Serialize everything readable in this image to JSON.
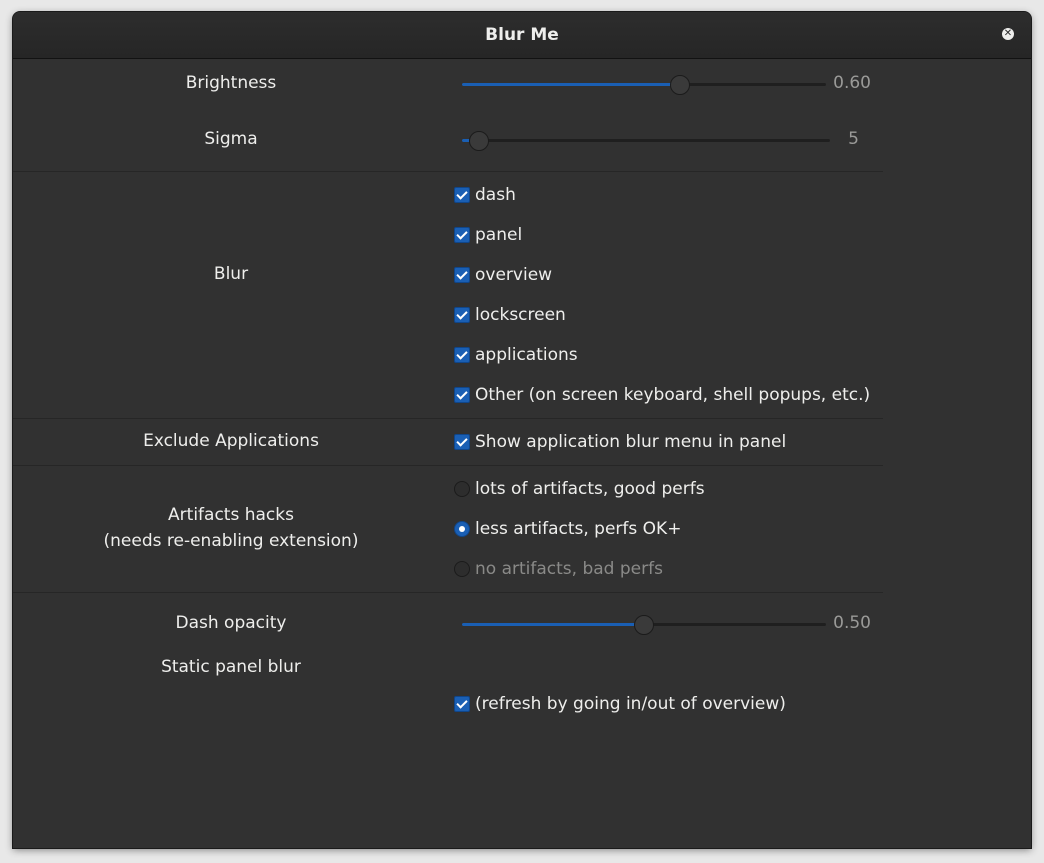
{
  "window": {
    "title": "Blur Me",
    "close_symbol": "✕"
  },
  "brightness": {
    "label": "Brightness",
    "value": 0.6,
    "value_text": "0.60"
  },
  "sigma": {
    "label": "Sigma",
    "value": 5,
    "max": 111,
    "value_text": "5"
  },
  "blur": {
    "label": "Blur",
    "options": [
      {
        "label": "dash",
        "checked": true
      },
      {
        "label": "panel",
        "checked": true
      },
      {
        "label": "overview",
        "checked": true
      },
      {
        "label": "lockscreen",
        "checked": true
      },
      {
        "label": "applications",
        "checked": true
      },
      {
        "label": "Other (on screen keyboard, shell popups, etc.)",
        "checked": true
      }
    ]
  },
  "exclude_applications": {
    "label": "Exclude Applications",
    "option_label": "Show application blur menu in panel",
    "checked": true
  },
  "artifacts": {
    "label_line1": "Artifacts hacks",
    "label_line2": "(needs re-enabling extension)",
    "options": [
      {
        "label": "lots of artifacts, good perfs",
        "selected": false
      },
      {
        "label": "less artifacts, perfs OK+",
        "selected": true
      },
      {
        "label": "no artifacts, bad perfs",
        "selected": false
      }
    ]
  },
  "dash_opacity": {
    "label": "Dash opacity",
    "value": 0.5,
    "value_text": "0.50"
  },
  "static_panel_blur": {
    "label": "Static panel blur",
    "option_label": "(refresh by going in/out of overview)",
    "checked": true
  },
  "colors": {
    "accent": "#1a5fb4",
    "background": "#313131",
    "text": "#eeeeec"
  }
}
